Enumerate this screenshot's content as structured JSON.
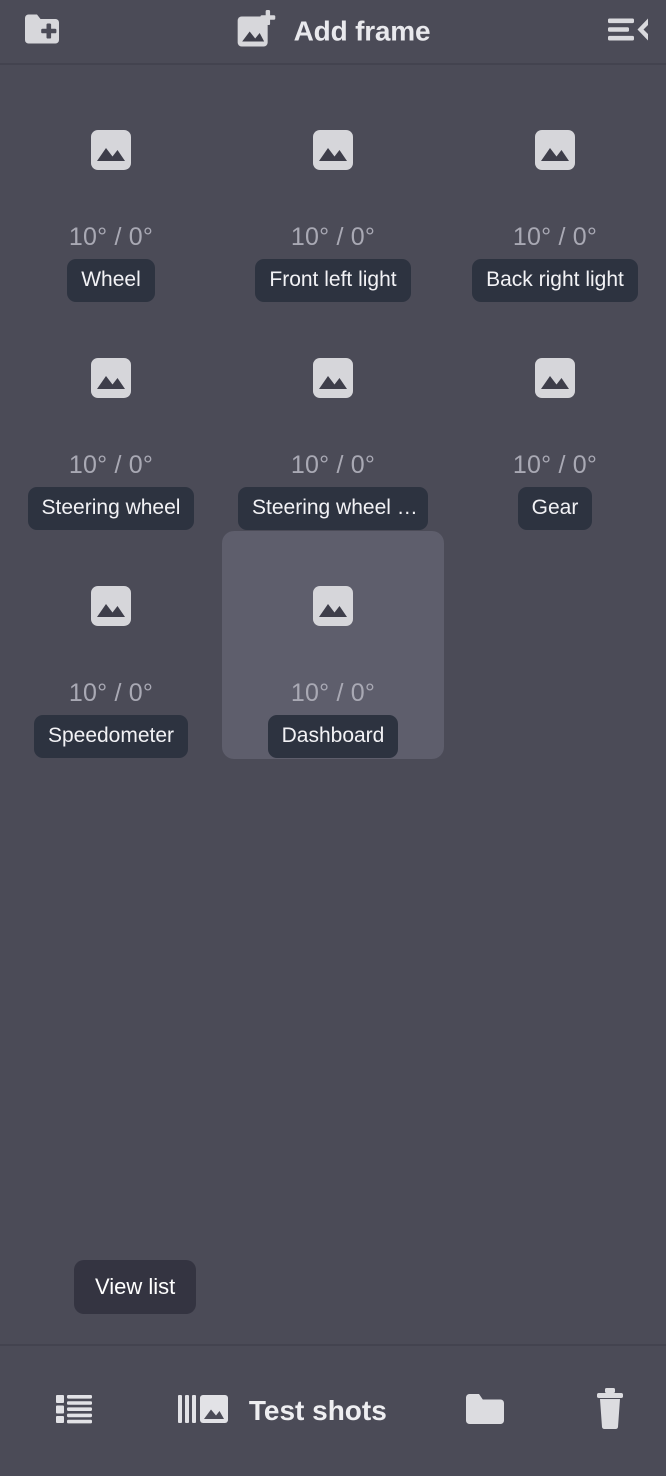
{
  "topbar": {
    "add_folder_icon": "folder-plus-icon",
    "add_frame_icon": "image-plus-icon",
    "add_frame_label": "Add frame",
    "menu_icon": "hamburger-collapse-icon"
  },
  "grid": {
    "thumb_icon": "image-placeholder-icon",
    "items": [
      {
        "angles": "10° / 0°",
        "name": "Wheel",
        "selected": false
      },
      {
        "angles": "10° / 0°",
        "name": "Front left light",
        "selected": false
      },
      {
        "angles": "10° / 0°",
        "name": "Back right light",
        "selected": false
      },
      {
        "angles": "10° / 0°",
        "name": "Steering wheel",
        "selected": false
      },
      {
        "angles": "10° / 0°",
        "name": "Steering wheel …",
        "selected": false
      },
      {
        "angles": "10° / 0°",
        "name": "Gear",
        "selected": false
      },
      {
        "angles": "10° / 0°",
        "name": "Speedometer",
        "selected": false
      },
      {
        "angles": "10° / 0°",
        "name": "Dashboard",
        "selected": true
      }
    ]
  },
  "tooltip": {
    "text": "View list"
  },
  "bottombar": {
    "list_icon": "list-view-icon",
    "test_shots_icon": "filmstrip-image-icon",
    "test_shots_label": "Test shots",
    "folder_icon": "folder-icon",
    "trash_icon": "trash-icon"
  },
  "colors": {
    "background": "#4b4b57",
    "bar_background": "#4b4b57",
    "divider": "#43434f",
    "selected_cell": "#5e5e6c",
    "pill_background": "#2d3340",
    "pill_text": "#f2f2f5",
    "angles_text": "#a9a9b4",
    "icon_light": "#d6d6da",
    "tooltip_background": "#343441",
    "title_text": "#e9e9ed"
  }
}
